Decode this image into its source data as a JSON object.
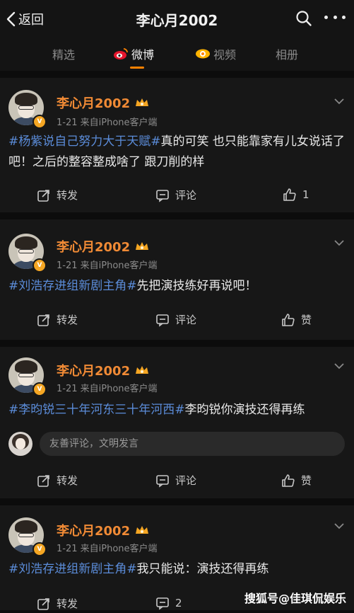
{
  "header": {
    "back_label": "返回",
    "title": "李心月2002",
    "icons": [
      "back-chevron-icon",
      "search-icon",
      "more-icon"
    ]
  },
  "tabs": [
    {
      "label": "精选",
      "active": false
    },
    {
      "label": "微博",
      "active": true,
      "icon": "weibo-logo-icon"
    },
    {
      "label": "视频",
      "active": false,
      "icon": "video-eye-icon"
    },
    {
      "label": "相册",
      "active": false
    }
  ],
  "colors": {
    "accent": "#ff8200",
    "username": "#f08a35",
    "hashtag": "#5b8cd9"
  },
  "posts": [
    {
      "username": "李心月2002",
      "meta": "1-21  来自iPhone客户端",
      "text_segments": [
        {
          "text": "#杨紫说自己努力大于天赋#",
          "tag": true
        },
        {
          "text": "真的可笑 也只能靠家有儿女说话了吧！之后的整容整成啥了 跟刀削的样",
          "tag": false
        }
      ],
      "actions": {
        "repost": "转发",
        "comment": "评论",
        "like": "1"
      }
    },
    {
      "username": "李心月2002",
      "meta": "1-21  来自iPhone客户端",
      "text_segments": [
        {
          "text": "#刘浩存进组新剧主角#",
          "tag": true
        },
        {
          "text": "先把演技练好再说吧！",
          "tag": false
        }
      ],
      "actions": {
        "repost": "转发",
        "comment": "评论",
        "like": "赞"
      }
    },
    {
      "username": "李心月2002",
      "meta": "1-21  来自iPhone客户端",
      "text_segments": [
        {
          "text": "#李昀锐三十年河东三十年河西#",
          "tag": true
        },
        {
          "text": "李昀锐你演技还得再练",
          "tag": false
        }
      ],
      "comment_placeholder": "友善评论，文明发言",
      "actions": {
        "repost": "转发",
        "comment": "评论",
        "like": "赞"
      }
    },
    {
      "username": "李心月2002",
      "meta": "1-21  来自iPhone客户端",
      "text_segments": [
        {
          "text": "#刘浩存进组新剧主角#",
          "tag": true
        },
        {
          "text": "我只能说：演技还得再练",
          "tag": false
        }
      ],
      "actions": {
        "repost": "转发",
        "comment": "2"
      }
    }
  ],
  "watermark": "搜狐号@佳琪侃娱乐"
}
